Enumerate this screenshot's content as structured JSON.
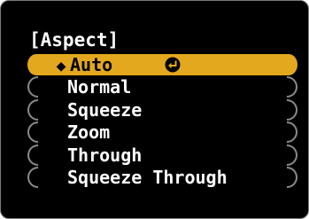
{
  "menu": {
    "title": "[Aspect]",
    "items": [
      {
        "label": "Auto",
        "selected": true
      },
      {
        "label": "Normal"
      },
      {
        "label": "Squeeze"
      },
      {
        "label": "Zoom"
      },
      {
        "label": "Through"
      },
      {
        "label": "Squeeze Through"
      }
    ]
  },
  "icons": {
    "selected_marker": "up-down-diamond-icon",
    "confirm": "enter-icon"
  },
  "colors": {
    "background": "#000000",
    "highlight": "#e3a81d",
    "text": "#ffffff",
    "selected_text": "#000000"
  }
}
